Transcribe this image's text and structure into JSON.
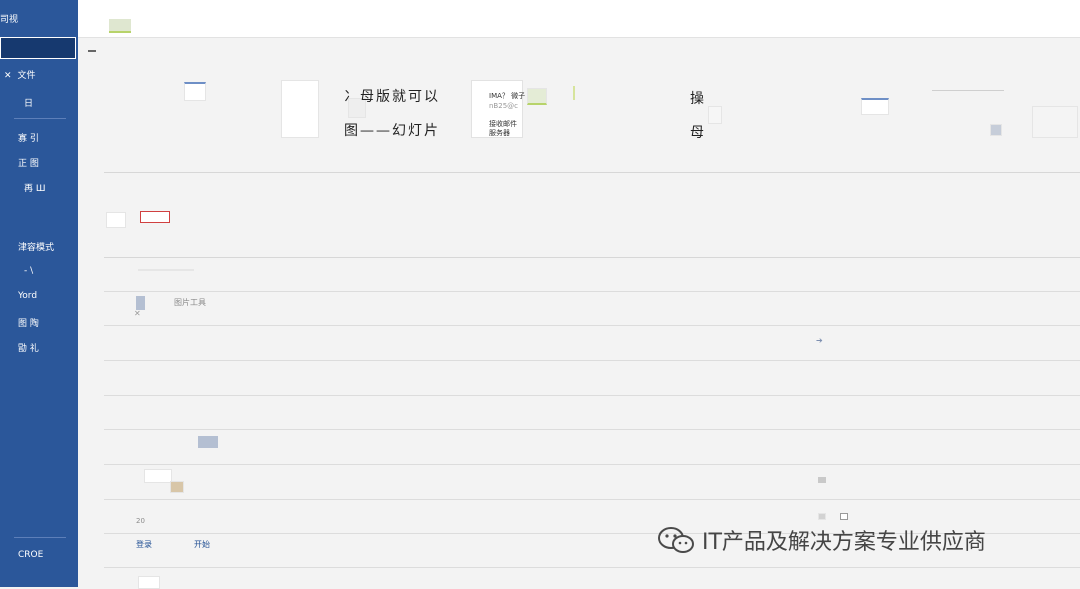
{
  "sidebar": {
    "title": "司视",
    "selected": "",
    "file_label": "文件",
    "items": [
      "日",
      "寡 引",
      "正 图",
      "再 Ш",
      "津容模式",
      "- \\",
      "Yord",
      "图 陶",
      "勖 礼",
      "CROE"
    ]
  },
  "preview": {
    "text_line1": "冫母版就可以",
    "text_line2": "图——幻灯片",
    "card_line1": "IMA？ 微子",
    "card_line2": "nB25@c",
    "card_line3": "接收邮件",
    "card_line4": "服务器",
    "op_char1": "操",
    "op_char2": "母"
  },
  "rows": {
    "image_tool_label": "图片工具",
    "login_label": "登录",
    "start_label": "开始",
    "number_label": "20"
  },
  "watermark": {
    "text": "IT产品及解决方案专业供应商"
  },
  "colors": {
    "sidebar_bg": "#2b579a",
    "accent_link": "#1f4e93"
  }
}
